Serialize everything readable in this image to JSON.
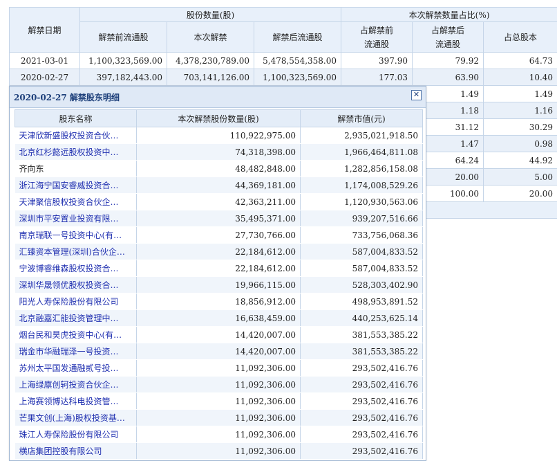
{
  "main": {
    "col_date": "解禁日期",
    "group_shares": "股份数量(股)",
    "group_ratio": "本次解禁数量占比(%)",
    "col_before": "解禁前流通股",
    "col_this": "本次解禁",
    "col_after": "解禁后流通股",
    "col_pct_before": "占解禁前流通股",
    "col_pct_after": "占解禁后流通股",
    "col_pct_total": "占总股本",
    "rows": [
      {
        "date": "2021-03-01",
        "before": "1,100,323,569.00",
        "this": "4,378,230,789.00",
        "after": "5,478,554,358.00",
        "p1": "397.90",
        "p2": "79.92",
        "p3": "64.73"
      },
      {
        "date": "2020-02-27",
        "before": "397,182,443.00",
        "this": "703,141,126.00",
        "after": "1,100,323,569.00",
        "p1": "177.03",
        "p2": "63.90",
        "p3": "10.40"
      },
      {
        "date": "",
        "before": "",
        "this": "",
        "after": "",
        "p1": "",
        "p2": "1.49",
        "p3": "1.49"
      },
      {
        "date": "",
        "before": "",
        "this": "",
        "after": "",
        "p1": "",
        "p2": "1.18",
        "p3": "1.16"
      },
      {
        "date": "",
        "before": "",
        "this": "",
        "after": "",
        "p1": "",
        "p2": "31.12",
        "p3": "30.29"
      },
      {
        "date": "",
        "before": "",
        "this": "",
        "after": "",
        "p1": "",
        "p2": "1.47",
        "p3": "0.98"
      },
      {
        "date": "",
        "before": "",
        "this": "",
        "after": "",
        "p1": "",
        "p2": "64.24",
        "p3": "44.92"
      },
      {
        "date": "",
        "before": "",
        "this": "",
        "after": "",
        "p1": "",
        "p2": "20.00",
        "p3": "5.00"
      },
      {
        "date": "",
        "before": "",
        "this": "",
        "after": "",
        "p1": "",
        "p2": "100.00",
        "p3": "20.00"
      }
    ]
  },
  "popup": {
    "title": "2020-02-27 解禁股东明细",
    "close_icon": "✕",
    "col_name": "股东名称",
    "col_shares": "本次解禁股份数量(股)",
    "col_value": "解禁市值(元)",
    "rows": [
      {
        "name": "天津欣新盛股权投资合伙…",
        "shares": "110,922,975.00",
        "value": "2,935,021,918.50",
        "link": true
      },
      {
        "name": "北京红杉懿远股权投资中…",
        "shares": "74,318,398.00",
        "value": "1,966,464,811.08",
        "link": true
      },
      {
        "name": "齐向东",
        "shares": "48,482,848.00",
        "value": "1,282,856,158.08",
        "link": false
      },
      {
        "name": "浙江海宁国安睿威投资合…",
        "shares": "44,369,181.00",
        "value": "1,174,008,529.26",
        "link": true
      },
      {
        "name": "天津聚信股权投资合伙企…",
        "shares": "42,363,211.00",
        "value": "1,120,930,563.06",
        "link": true
      },
      {
        "name": "深圳市平安置业投资有限…",
        "shares": "35,495,371.00",
        "value": "939,207,516.66",
        "link": true
      },
      {
        "name": "南京瑞联一号投资中心(有…",
        "shares": "27,730,766.00",
        "value": "733,756,068.36",
        "link": true
      },
      {
        "name": "汇臻资本管理(深圳)合伙企…",
        "shares": "22,184,612.00",
        "value": "587,004,833.52",
        "link": true
      },
      {
        "name": "宁波博睿维森股权投资合…",
        "shares": "22,184,612.00",
        "value": "587,004,833.52",
        "link": true
      },
      {
        "name": "深圳华晟领优股权投资合…",
        "shares": "19,966,115.00",
        "value": "528,303,402.90",
        "link": true
      },
      {
        "name": "阳光人寿保险股份有限公司",
        "shares": "18,856,912.00",
        "value": "498,953,891.52",
        "link": true
      },
      {
        "name": "北京融嘉汇能投资管理中…",
        "shares": "16,638,459.00",
        "value": "440,253,625.14",
        "link": true
      },
      {
        "name": "烟台民和昊虎投资中心(有…",
        "shares": "14,420,007.00",
        "value": "381,553,385.22",
        "link": true
      },
      {
        "name": "瑞金市华融瑞泽一号投资…",
        "shares": "14,420,007.00",
        "value": "381,553,385.22",
        "link": true
      },
      {
        "name": "苏州太平国发通融贰号投…",
        "shares": "11,092,306.00",
        "value": "293,502,416.76",
        "link": true
      },
      {
        "name": "上海绿廪创轲投资合伙企…",
        "shares": "11,092,306.00",
        "value": "293,502,416.76",
        "link": true
      },
      {
        "name": "上海赛领博达科电投资管…",
        "shares": "11,092,306.00",
        "value": "293,502,416.76",
        "link": true
      },
      {
        "name": "芒果文创(上海)股权投资基…",
        "shares": "11,092,306.00",
        "value": "293,502,416.76",
        "link": true
      },
      {
        "name": "珠江人寿保险股份有限公司",
        "shares": "11,092,306.00",
        "value": "293,502,416.76",
        "link": true
      },
      {
        "name": "横店集团控股有限公司",
        "shares": "11,092,306.00",
        "value": "293,502,416.76",
        "link": true
      }
    ]
  }
}
